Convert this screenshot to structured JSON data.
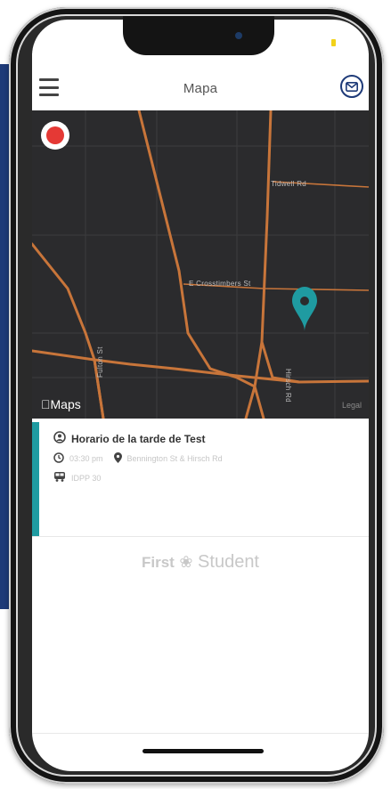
{
  "header": {
    "title": "Mapa"
  },
  "map": {
    "attribution": "Maps",
    "legal": "Legal",
    "roads": [
      "Tidwell Rd",
      "E Crosstimbers St",
      "Fulton St",
      "Hirsch Rd"
    ]
  },
  "trip": {
    "title": "Horario de la tarde de Test",
    "time": "03:30 pm",
    "location": "Bennington St & Hirsch Rd",
    "bus": "IDPP 30"
  },
  "brand": {
    "first": "First",
    "second": "Student"
  },
  "colors": {
    "accent": "#1f9ba1",
    "record": "#e53935",
    "roads": "#c8753a",
    "nav": "#1e3a78"
  }
}
